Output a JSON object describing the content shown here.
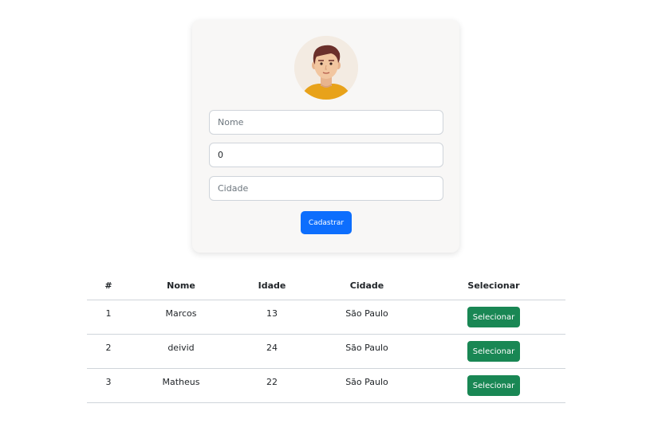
{
  "form": {
    "name_placeholder": "Nome",
    "age_value": "0",
    "city_placeholder": "Cidade",
    "submit_label": "Cadastrar",
    "avatar_icon": "person-avatar-icon"
  },
  "table": {
    "headers": [
      "#",
      "Nome",
      "Idade",
      "Cidade",
      "Selecionar"
    ],
    "rows": [
      {
        "id": "1",
        "name": "Marcos",
        "age": "13",
        "city": "São Paulo",
        "action": "Selecionar"
      },
      {
        "id": "2",
        "name": "deivid",
        "age": "24",
        "city": "São Paulo",
        "action": "Selecionar"
      },
      {
        "id": "3",
        "name": "Matheus",
        "age": "22",
        "city": "São Paulo",
        "action": "Selecionar"
      }
    ]
  },
  "colors": {
    "primary": "#0d6efd",
    "success": "#198754",
    "card_bg": "#f8f7f6"
  }
}
